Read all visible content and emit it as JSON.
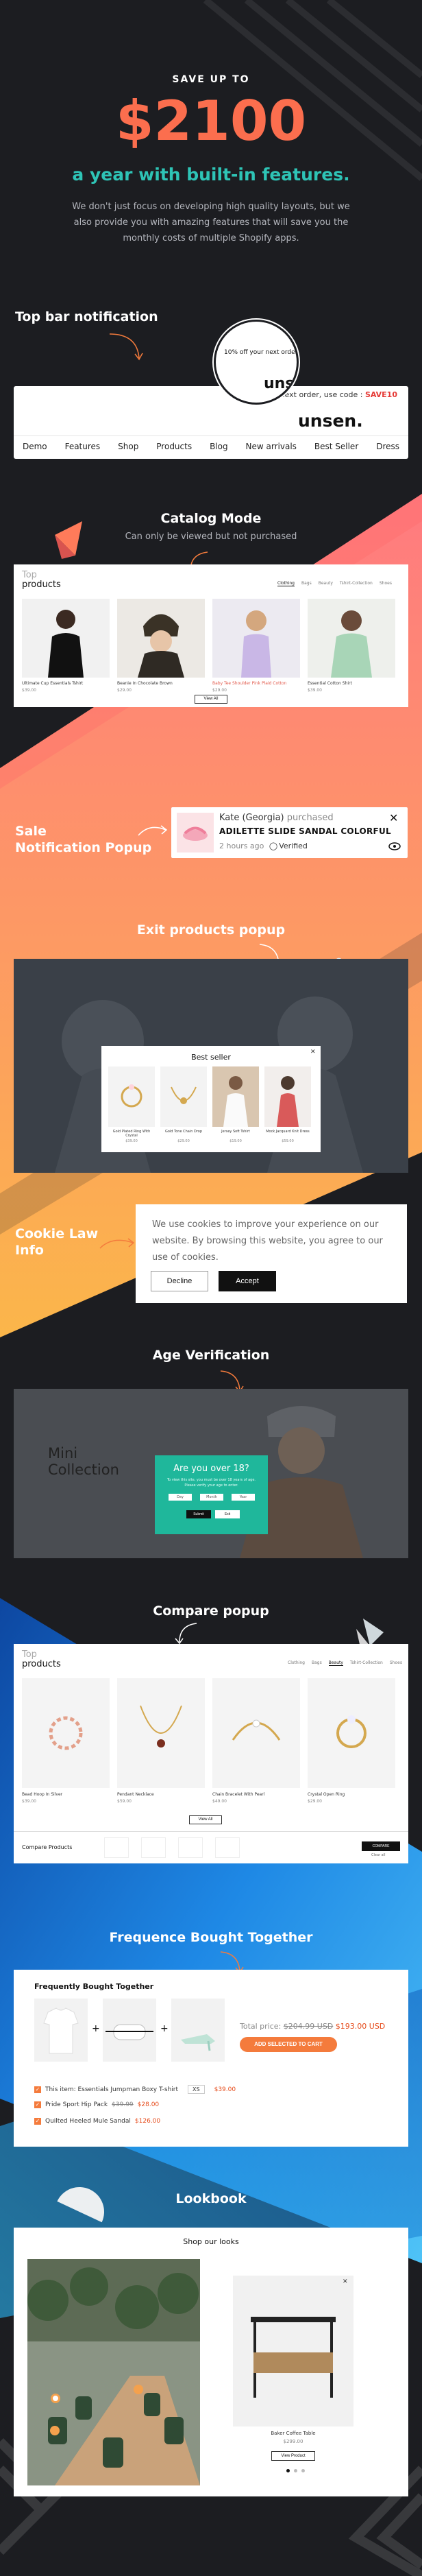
{
  "colors": {
    "bg": "#1c1d21",
    "accent": "#fb6e4e",
    "teal": "#2ec4b6",
    "orange": "#f47b3c",
    "blue": "#1e88e5"
  },
  "hero": {
    "kicker": "SAVE UP TO",
    "amount": "$2100",
    "tagline": "a year with built-in features.",
    "desc": "We don't just focus on developing high quality layouts, but we also provide you with amazing features that will save you the monthly costs of multiple Shopify apps."
  },
  "topbar": {
    "title": "Top bar notification",
    "bubble_text": "10% off your next order",
    "bubble_logo": "uns",
    "strip_text": "next order, use code :",
    "code": "SAVE10",
    "logo": "unsen.",
    "nav": [
      "Demo",
      "Features",
      "Shop",
      "Products",
      "Blog",
      "New arrivals",
      "Best Seller",
      "Dress"
    ]
  },
  "catalog": {
    "title": "Catalog Mode",
    "subtitle": "Can only be viewed but not purchased",
    "heading_top": "Top",
    "heading_main": "products",
    "tabs": [
      "Clothing",
      "Bags",
      "Beauty",
      "Tshirt-Collection",
      "Shoes"
    ],
    "products": [
      {
        "name": "Ultimate Cup Essentials Tshirt",
        "price": "$39.00"
      },
      {
        "name": "Beanie In Chocolate Brown",
        "price": "$29.00"
      },
      {
        "name": "Baby Tee Shoulder Pink Plaid Cotton",
        "price": "$29.00"
      },
      {
        "name": "Essential Cotton Shirt",
        "price": "$39.00"
      }
    ],
    "view_all": "View All"
  },
  "sale": {
    "title_line1": "Sale",
    "title_line2": "Notification Popup",
    "buyer": "Kate (Georgia)",
    "action": "purchased",
    "product": "ADILETTE SLIDE SANDAL COLORFUL",
    "time": "2 hours ago",
    "verified": "Verified"
  },
  "exit": {
    "title": "Exit products popup",
    "popup_title": "Best seller",
    "products": [
      {
        "name": "Gold Plated Ring With Crystal",
        "price": "$39.00"
      },
      {
        "name": "Gold Tone Chain Drop",
        "price": "$29.00"
      },
      {
        "name": "Jersey Soft Tshirt",
        "price": "$19.00"
      },
      {
        "name": "Mock Jacquard Knit Dress",
        "price": "$59.00"
      }
    ]
  },
  "cookie": {
    "title_line1": "Cookie Law",
    "title_line2": "Info",
    "text": "We use cookies to improve your experience on our website. By browsing this website, you agree to our use of cookies.",
    "decline": "Decline",
    "accept": "Accept"
  },
  "age": {
    "title": "Age Verification",
    "banner_line1": "Mini",
    "banner_line2": "Collection",
    "question": "Are you over 18?",
    "note": "To view this site, you must be over 18 years of age. Please verify your age to enter.",
    "submit": "Submit",
    "exit": "Exit",
    "fields": [
      "Day",
      "Month",
      "Year"
    ]
  },
  "compare": {
    "title": "Compare popup",
    "heading_top": "Top",
    "heading_main": "products",
    "tabs": [
      "Clothing",
      "Bags",
      "Beauty",
      "Tshirt-Collection",
      "Shoes"
    ],
    "products": [
      {
        "name": "Bead Hoop In Silver",
        "price": "$39.00"
      },
      {
        "name": "Pendant Necklace",
        "price": "$59.00"
      },
      {
        "name": "Chain Bracelet With Pearl",
        "price": "$49.00"
      },
      {
        "name": "Crystal Open Ring",
        "price": "$29.00"
      }
    ],
    "view_all": "View All",
    "bar_title": "Compare Products",
    "compare_btn": "COMPARE",
    "clear": "Clear all"
  },
  "fbt": {
    "title": "Frequence Bought Together",
    "card_title": "Frequently Bought Together",
    "total_label": "Total price:",
    "old_price": "$204.99 USD",
    "new_price": "$193.00 USD",
    "add_btn": "ADD SELECTED TO CART",
    "items": [
      {
        "name": "This item: Essentials Jumpman Boxy T-shirt",
        "price": "$39.00",
        "qty": "XS"
      },
      {
        "name": "Pride Sport Hip Pack",
        "old": "$39.99",
        "price": "$28.00"
      },
      {
        "name": "Quilted Heeled Mule Sandal",
        "price": "$126.00"
      }
    ]
  },
  "lookbook": {
    "title": "Lookbook",
    "shop_title": "Shop our looks",
    "product_name": "Baker Coffee Table",
    "product_price": "$299.00",
    "view_btn": "View Product"
  }
}
